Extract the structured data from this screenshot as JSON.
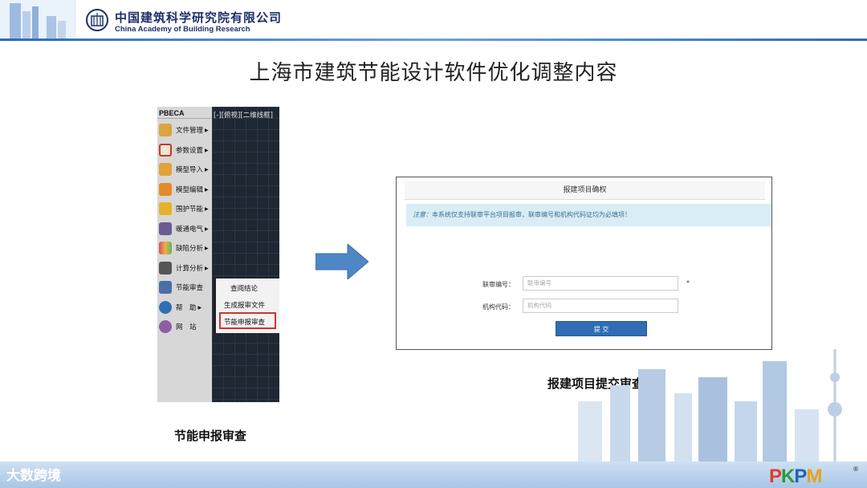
{
  "header": {
    "org_name_cn": "中国建筑科学研究院有限公司",
    "org_name_en": "China Academy of Building Research"
  },
  "slide": {
    "title": "上海市建筑节能设计软件优化调整内容"
  },
  "software": {
    "app_name": "PBECA",
    "view_label": "[-][俯视][二维线框]",
    "menu": [
      {
        "label": "文件管理",
        "arrow": "▶",
        "icon": "folder-box-icon",
        "color": "#d9a441"
      },
      {
        "label": "参数设置",
        "arrow": "▶",
        "icon": "edit-pencil-icon",
        "color": "#c0392b"
      },
      {
        "label": "模型导入",
        "arrow": "▶",
        "icon": "import-box-icon",
        "color": "#e0a33a"
      },
      {
        "label": "模型编辑",
        "arrow": "▶",
        "icon": "edit-model-icon",
        "color": "#e58a2a"
      },
      {
        "label": "围护节能",
        "arrow": "▶",
        "icon": "envelope-icon",
        "color": "#e6b22b"
      },
      {
        "label": "暖通电气",
        "arrow": "▶",
        "icon": "hvac-icon",
        "color": "#6b5b95"
      },
      {
        "label": "缺陷分析",
        "arrow": "▶",
        "icon": "analysis-chart-icon",
        "color": "#d9534f"
      },
      {
        "label": "计算分析",
        "arrow": "▶",
        "icon": "calculate-icon",
        "color": "#555555"
      },
      {
        "label": "节能审查",
        "arrow": "",
        "icon": "review-folder-icon",
        "color": "#4a6fa5"
      },
      {
        "label": "帮　助",
        "arrow": "▶",
        "icon": "help-icon",
        "color": "#2f6eb5"
      },
      {
        "label": "网　站",
        "arrow": "",
        "icon": "website-icon",
        "color": "#8e5ea2"
      }
    ],
    "submenu": [
      {
        "label": "查阅结论"
      },
      {
        "label": "生成报审文件"
      },
      {
        "label": "节能申报审查"
      }
    ]
  },
  "form": {
    "title": "报建项目确权",
    "notice_prefix": "注意：",
    "notice_text": "本系统仅支持联审平台项目报审，联审编号和机构代码证均为必填项！",
    "fields": [
      {
        "label": "联审编号：",
        "placeholder": "联审编号",
        "required": "*"
      },
      {
        "label": "机构代码：",
        "placeholder": "机构代码",
        "required": ""
      }
    ],
    "submit_label": "提 交"
  },
  "captions": {
    "left": "节能申报审查",
    "right": "报建项目提交审查"
  },
  "footer": {
    "watermark": "大数跨境",
    "brand": {
      "p1": "P",
      "k": "K",
      "p2": "P",
      "m": "M"
    },
    "registered": "®"
  }
}
